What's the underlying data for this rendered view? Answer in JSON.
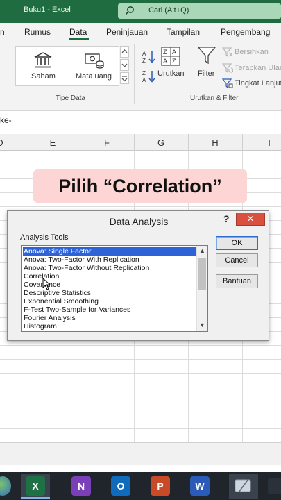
{
  "window": {
    "title": "Buku1  -  Excel",
    "search_placeholder": "Cari (Alt+Q)"
  },
  "menu": {
    "tabs": [
      "n",
      "Rumus",
      "Data",
      "Peninjauan",
      "Tampilan",
      "Pengembang"
    ],
    "active": "Data"
  },
  "ribbon": {
    "data_types": {
      "saham": "Saham",
      "mata_uang": "Mata uang",
      "group_label": "Tipe Data"
    },
    "sort": {
      "urutkan": "Urutkan",
      "filter": "Filter",
      "group_label": "Urutkan & Filter"
    },
    "filter_options": {
      "bersihkan": "Bersihkan",
      "terapkan_ulang": "Terapkan Ulang",
      "tingkat_lanjut": "Tingkat Lanjutan"
    }
  },
  "formula_bar": {
    "text": "ke-"
  },
  "columns": [
    "D",
    "E",
    "F",
    "G",
    "H",
    "I"
  ],
  "caption": {
    "text": "Pilih “Correlation”"
  },
  "dialog": {
    "title": "Data Analysis",
    "help": "?",
    "close": "✕",
    "tools_label": "Analysis Tools",
    "tools": [
      "Anova: Single Factor",
      "Anova: Two-Factor With Replication",
      "Anova: Two-Factor Without Replication",
      "Correlation",
      "Covariance",
      "Descriptive Statistics",
      "Exponential Smoothing",
      "F-Test Two-Sample for Variances",
      "Fourier Analysis",
      "Histogram"
    ],
    "selected_index": 0,
    "buttons": {
      "ok": "OK",
      "cancel": "Cancel",
      "help": "Bantuan"
    }
  },
  "taskbar": {
    "apps": [
      {
        "label": "X",
        "name": "excel",
        "color": "#1e7145"
      },
      {
        "label": "N",
        "name": "onenote",
        "color": "#7b3fb8"
      },
      {
        "label": "O",
        "name": "outlook",
        "color": "#0f6cbd"
      },
      {
        "label": "P",
        "name": "powerpoint",
        "color": "#c94a26"
      },
      {
        "label": "W",
        "name": "word",
        "color": "#2a5bb8"
      }
    ]
  },
  "colors": {
    "excel_green": "#1e6c40",
    "selection_blue": "#2e63d8",
    "caption_bg": "#fdd5d5",
    "close_red": "#d9503f"
  }
}
